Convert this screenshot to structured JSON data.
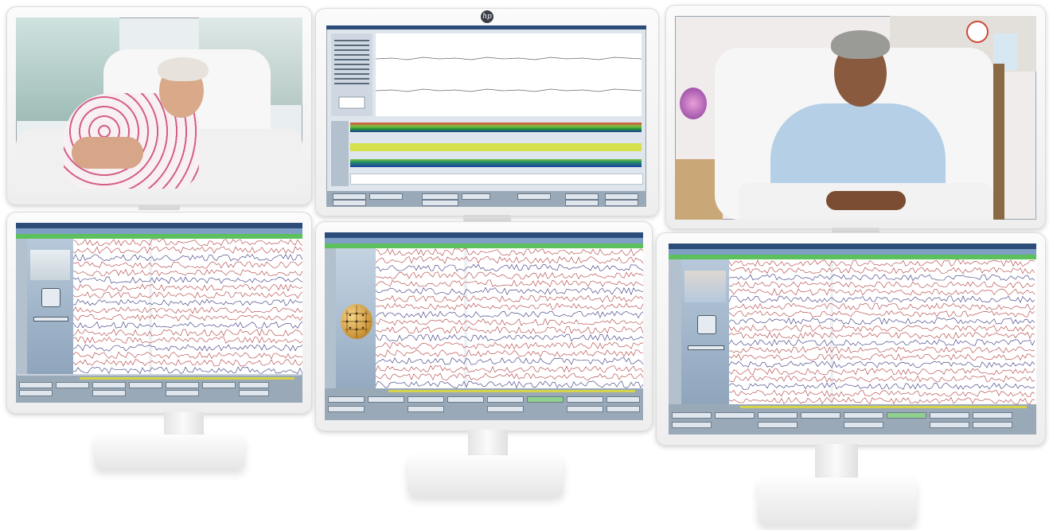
{
  "scene": {
    "description_free": true,
    "background_color": "#ffffff",
    "monitor_count": 6,
    "stand_count": 3
  },
  "monitors": [
    {
      "id": "top-left",
      "content": "patient-video",
      "subject": "woman-reclining-floral-gown"
    },
    {
      "id": "top-center",
      "content": "eeg-trend-software",
      "brand_icon": "hp-logo-icon"
    },
    {
      "id": "top-right",
      "content": "patient-video",
      "subject": "woman-sitting-blue-gown"
    },
    {
      "id": "bottom-left",
      "content": "eeg-waveform-software"
    },
    {
      "id": "bottom-center",
      "content": "eeg-waveform-software",
      "widget": "3d-head-electrode-model"
    },
    {
      "id": "bottom-right",
      "content": "eeg-waveform-software"
    }
  ],
  "colors": {
    "software_titlebar": "#2c4d7a",
    "software_accent_green": "#5cc15c",
    "trace_red": "#b03a3a",
    "trace_blue": "#30307a",
    "trend_green": "#7bc242",
    "trend_blue": "#1f3fa0",
    "trend_yellow": "#d6e04a"
  }
}
